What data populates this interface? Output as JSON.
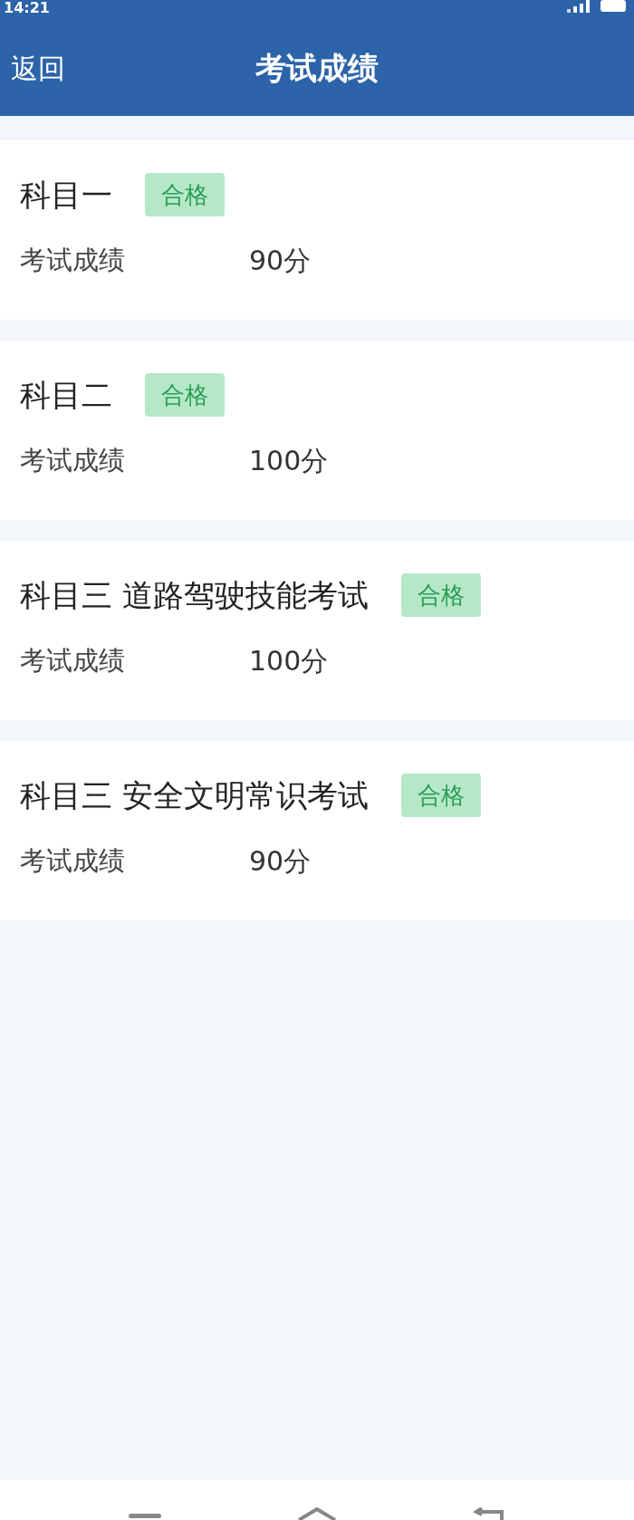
{
  "status_bar": {
    "time": "14:21"
  },
  "header": {
    "back": "返回",
    "title": "考试成绩"
  },
  "results": [
    {
      "subject": "科目一",
      "status": "合格",
      "passed": true,
      "label": "考试成绩",
      "score": "90分"
    },
    {
      "subject": "科目二",
      "status": "合格",
      "passed": true,
      "label": "考试成绩",
      "score": "100分"
    },
    {
      "subject": "科目三 道路驾驶技能考试",
      "status": "合格",
      "passed": true,
      "label": "考试成绩",
      "score": "100分"
    },
    {
      "subject": "科目三 安全文明常识考试",
      "status": "合格",
      "passed": true,
      "label": "考试成绩",
      "score": "90分"
    }
  ]
}
